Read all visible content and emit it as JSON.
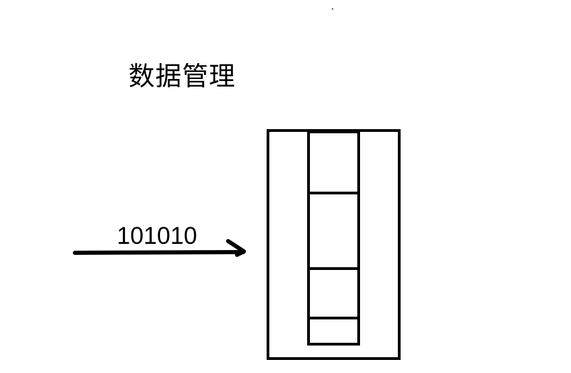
{
  "title": "数据管理",
  "arrow_label": "101010",
  "colors": {
    "ink": "#000000",
    "background": "#ffffff"
  }
}
